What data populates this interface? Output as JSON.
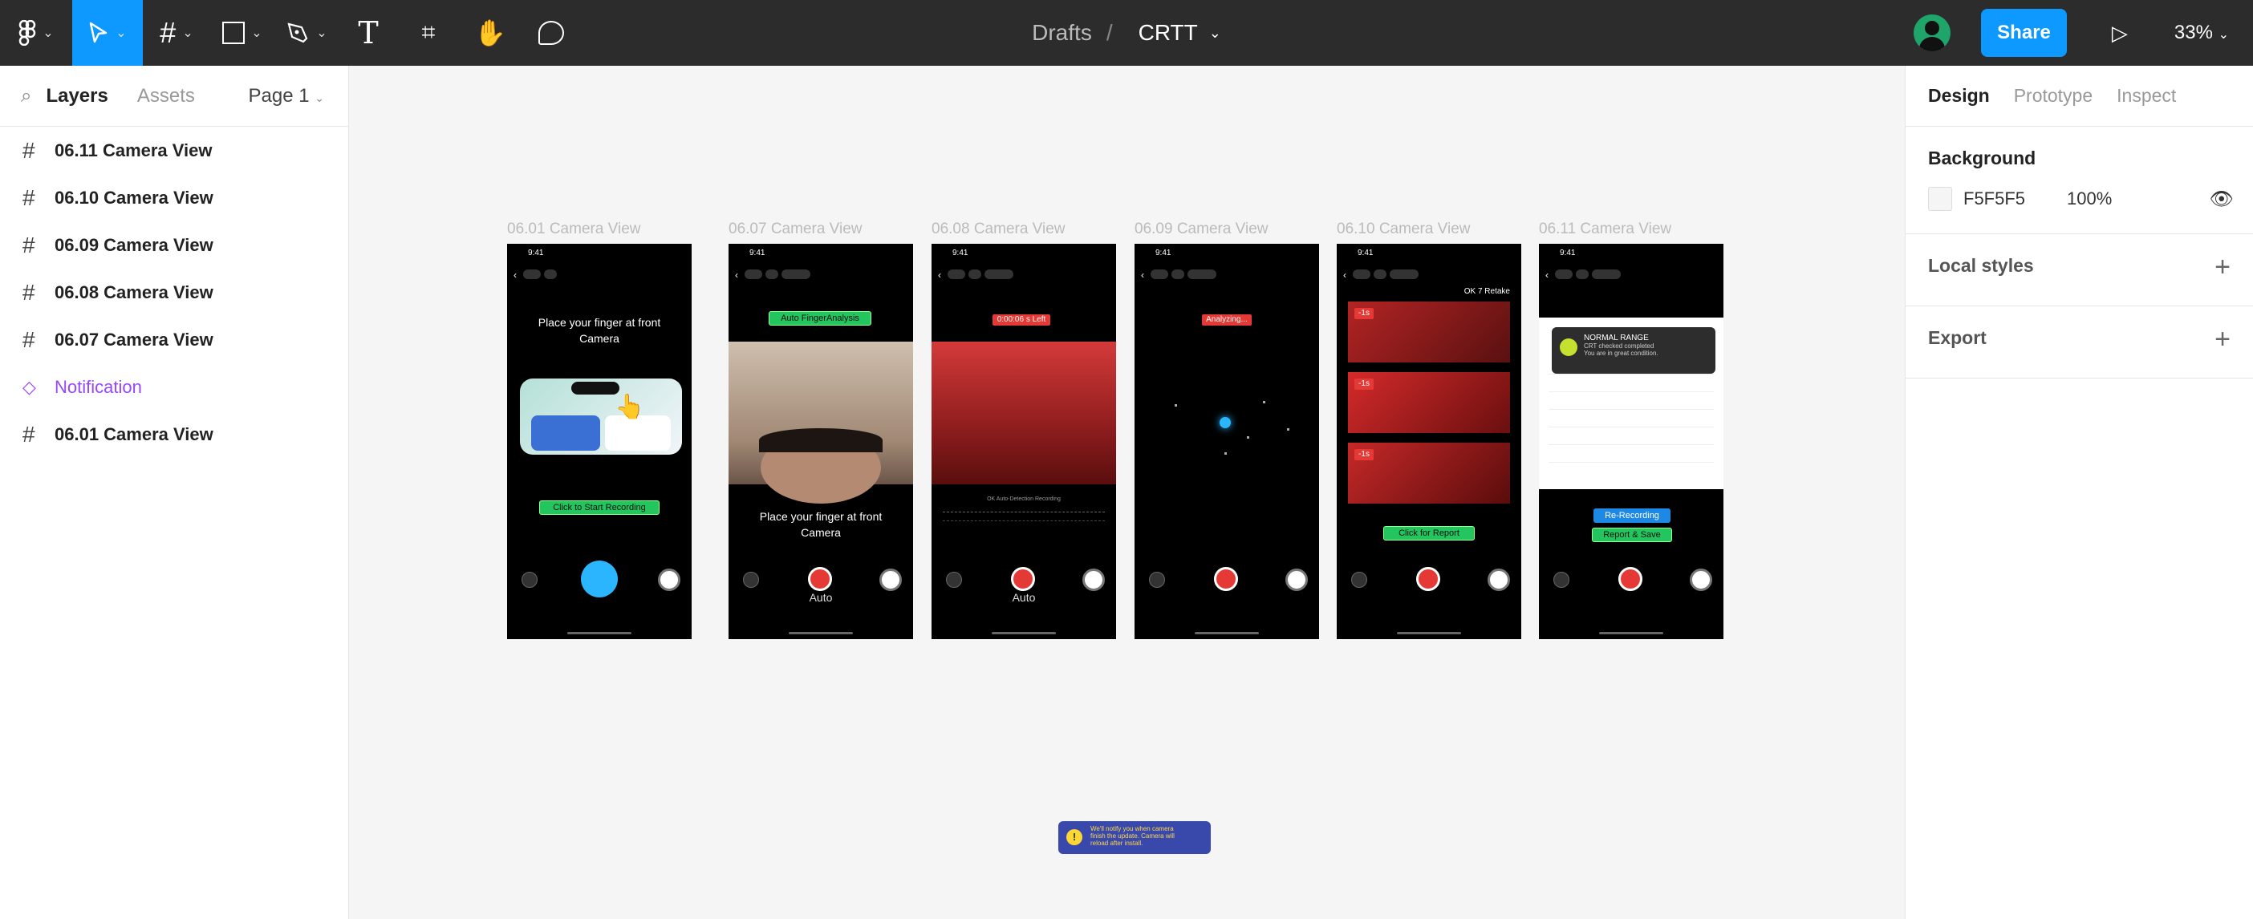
{
  "toolbar": {
    "tools": [
      "figma-menu",
      "move",
      "frame",
      "shape",
      "pen",
      "text",
      "components",
      "hand",
      "comment"
    ]
  },
  "breadcrumb": {
    "folder": "Drafts",
    "separator": "/",
    "file": "CRTT"
  },
  "header_right": {
    "share_label": "Share",
    "zoom": "33%"
  },
  "left_panel": {
    "tabs": {
      "layers": "Layers",
      "assets": "Assets"
    },
    "page": "Page 1",
    "layers": [
      {
        "name": "06.11 Camera View",
        "type": "frame"
      },
      {
        "name": "06.10 Camera View",
        "type": "frame"
      },
      {
        "name": "06.09 Camera View",
        "type": "frame"
      },
      {
        "name": "06.08 Camera View",
        "type": "frame"
      },
      {
        "name": "06.07 Camera View",
        "type": "frame"
      },
      {
        "name": "Notification",
        "type": "component"
      },
      {
        "name": "06.01 Camera View",
        "type": "frame"
      }
    ]
  },
  "right_panel": {
    "tabs": {
      "design": "Design",
      "prototype": "Prototype",
      "inspect": "Inspect"
    },
    "background": {
      "title": "Background",
      "hex": "F5F5F5",
      "opacity": "100%"
    },
    "local_styles": "Local styles",
    "export": "Export"
  },
  "canvas": {
    "frames": {
      "f1": {
        "label": "06.01 Camera View",
        "time": "9:41",
        "prompt": "Place your finger at front Camera",
        "button": "Click to Start Recording"
      },
      "f2": {
        "label": "06.07 Camera View",
        "time": "9:41",
        "button": "Auto FingerAnalysis",
        "prompt": "Place your finger at front Camera",
        "auto": "Auto"
      },
      "f3": {
        "label": "06.08 Camera View",
        "time": "9:41",
        "tag": "0:00:06 s Left",
        "caption": "OK Auto-Detection Recording",
        "auto": "Auto"
      },
      "f4": {
        "label": "06.09 Camera View",
        "time": "9:41",
        "tag": "Analyzing..."
      },
      "f5": {
        "label": "06.10 Camera View",
        "time": "9:41",
        "retake": "OK 7 Retake",
        "clips": [
          "-1s",
          "-1s",
          "-1s"
        ],
        "button": "Click for Report"
      },
      "f6": {
        "label": "06.11 Camera View",
        "time": "9:41",
        "status": "NORMAL RANGE",
        "status_l1": "CRT checked completed",
        "status_l2": "You are in great condition.",
        "btn1": "Re-Recording",
        "btn2": "Report & Save"
      }
    },
    "notification": {
      "l1": "We'll notify you when camera",
      "l2": "finish the update. Camera will",
      "l3": "reload after install."
    }
  }
}
